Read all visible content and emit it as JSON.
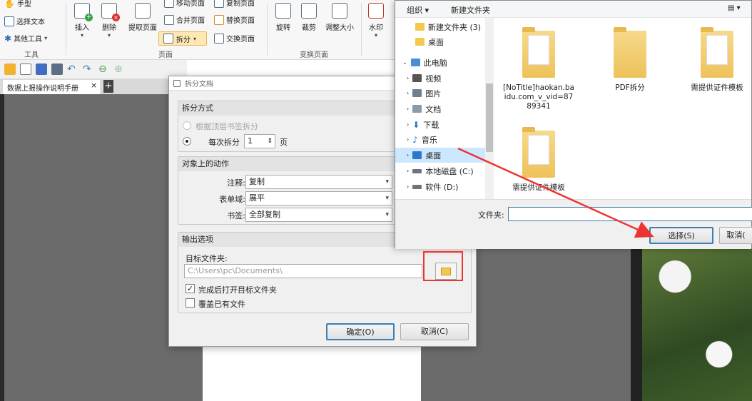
{
  "ribbon": {
    "hand_tool": "手型",
    "select_text": "选择文本",
    "other_tools": "其他工具",
    "group_tools": "工具",
    "insert": "插入",
    "delete": "删除",
    "extract_page": "提取页面",
    "move_page": "移动页面",
    "copy_page": "复制页面",
    "merge_page": "合并页面",
    "replace_page": "替换页面",
    "split": "拆分",
    "swap_page": "交换页面",
    "group_page": "页面",
    "rotate": "旋转",
    "crop": "裁剪",
    "resize": "调整大小",
    "group_transform": "变换页面",
    "watermark": "水印"
  },
  "tab": {
    "doc_name": "数据上报操作说明手册",
    "close": "×",
    "add": "+"
  },
  "split_dialog": {
    "title": "拆分文档",
    "split_mode_header": "拆分方式",
    "by_bookmark": "根据顶层书签拆分",
    "every_split": "每次拆分",
    "split_count": "1",
    "page_unit": "页",
    "actions_header": "对象上的动作",
    "annot_label": "注释:",
    "annot_value": "复制",
    "form_label": "表单域:",
    "form_value": "展平",
    "bookmark_label": "书签:",
    "bookmark_value": "全部复制",
    "output_header": "输出选项",
    "target_folder_label": "目标文件夹:",
    "target_folder_value": "C:\\Users\\pc\\Documents\\",
    "open_after": "完成后打开目标文件夹",
    "overwrite": "覆盖已有文件",
    "ok": "确定(O)",
    "cancel": "取消(C)"
  },
  "file_dialog": {
    "organize": "组织 ▾",
    "new_folder": "新建文件夹",
    "nav": [
      {
        "label": "新建文件夹 (3)",
        "color": "#f2c94c"
      },
      {
        "label": "桌面",
        "color": "#f2c94c"
      },
      {
        "label": "此电脑",
        "color": "#4a8fd6"
      },
      {
        "label": "视频",
        "color": "#555555"
      },
      {
        "label": "图片",
        "color": "#6f7f8f"
      },
      {
        "label": "文档",
        "color": "#8a9aa8"
      },
      {
        "label": "下载",
        "color": "#2f77c9"
      },
      {
        "label": "音乐",
        "color": "#2f77c9"
      },
      {
        "label": "桌面",
        "color": "#2f77c9"
      },
      {
        "label": "本地磁盘 (C:)",
        "color": "#6a7580"
      },
      {
        "label": "软件 (D:)",
        "color": "#6a7580"
      }
    ],
    "files": [
      {
        "name": "[NoTitle]haokan.baidu.com_v_vid=8789341"
      },
      {
        "name": "PDF拆分"
      },
      {
        "name": "需提供证件模板"
      },
      {
        "name": "需提供证件模板"
      }
    ],
    "folder_label": "文件夹:",
    "select_btn": "选择(S)",
    "cancel_btn": "取消("
  },
  "colors": {
    "accent": "#3c7fb1",
    "annotation": "#e33333",
    "split_highlight": "#fde7b3"
  }
}
